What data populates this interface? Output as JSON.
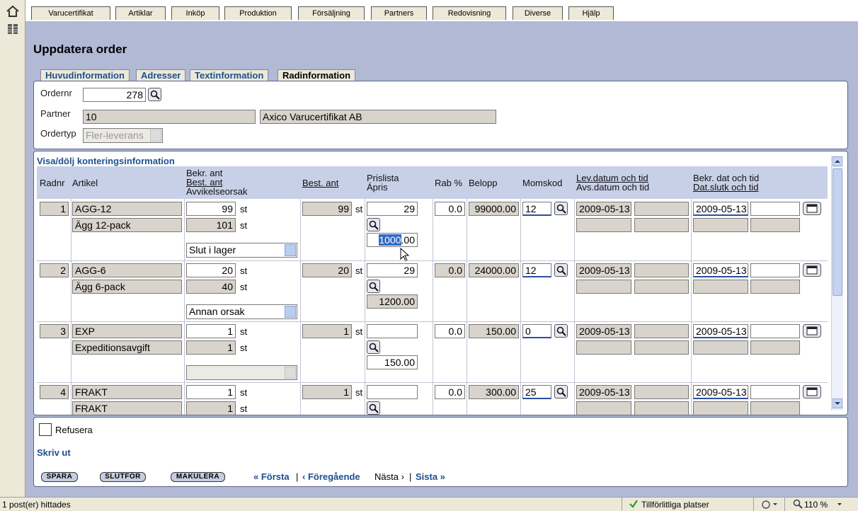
{
  "menu": [
    "Varucertifikat",
    "Artiklar",
    "Inköp",
    "Produktion",
    "Försäljning",
    "Partners",
    "Redovisning",
    "Diverse",
    "Hjälp"
  ],
  "title": "Uppdatera order",
  "tabs": [
    "Huvudinformation",
    "Adresser",
    "Textinformation",
    "Radinformation"
  ],
  "header": {
    "ordernr_label": "Ordernr",
    "ordernr": "278",
    "partner_label": "Partner",
    "partner_id": "10",
    "partner_name": "Axico Varucertifikat AB",
    "ordertyp_label": "Ordertyp",
    "ordertyp": "Fler-leverans"
  },
  "table": {
    "toggle": "Visa/dölj konteringsinformation",
    "col_radnr": "Radnr",
    "col_artikel": "Artikel",
    "col_bekr1": "Bekr. ant",
    "col_bekr2": "Best. ant",
    "col_bekr3": "Avvikelseorsak",
    "col_best": "Best. ant",
    "col_pris1": "Prislista",
    "col_pris2": "Ápris",
    "col_rab": "Rab %",
    "col_belopp": "Belopp",
    "col_moms": "Momskod",
    "col_lev1": "Lev.datum och tid",
    "col_lev2": "Avs.datum och tid",
    "col_bekrdat1": "Bekr. dat och tid",
    "col_bekrdat2": "Dat.slutk och tid",
    "unit": "st",
    "rows": [
      {
        "radnr": "1",
        "artikel": "AGG-12",
        "beskr": "Ägg 12-pack",
        "bekr": "99",
        "best2": "101",
        "orsak": "Slut i lager",
        "best": "99",
        "pris": "29",
        "apris_sel": "1000",
        "apris_rest": ".00",
        "rab": "0.0",
        "belopp": "99000.00",
        "moms": "12",
        "levdat": "2009-05-13",
        "bekrdat": "2009-05-13"
      },
      {
        "radnr": "2",
        "artikel": "AGG-6",
        "beskr": "Ägg 6-pack",
        "bekr": "20",
        "best2": "40",
        "orsak": "Annan orsak",
        "best": "20",
        "pris": "29",
        "apris": "1200.00",
        "rab": "0.0",
        "belopp": "24000.00",
        "moms": "12",
        "levdat": "2009-05-13",
        "bekrdat": "2009-05-13"
      },
      {
        "radnr": "3",
        "artikel": "EXP",
        "beskr": "Expeditionsavgift",
        "bekr": "1",
        "best2": "1",
        "orsak": "",
        "best": "1",
        "pris": "",
        "apris": "150.00",
        "rab": "0.0",
        "belopp": "150.00",
        "moms": "0",
        "levdat": "2009-05-13",
        "bekrdat": "2009-05-13"
      },
      {
        "radnr": "4",
        "artikel": "FRAKT",
        "beskr": "FRAKT",
        "bekr": "1",
        "best2": "1",
        "best": "1",
        "pris": "",
        "rab": "0.0",
        "belopp": "300.00",
        "moms": "25",
        "levdat": "2009-05-13",
        "bekrdat": "2009-05-13"
      }
    ]
  },
  "footer": {
    "refusera": "Refusera",
    "skriv_ut": "Skriv ut",
    "spara": "SPARA",
    "slutfor": "SLUTFÖR",
    "makulera": "MAKULERA",
    "forsta": "« Första",
    "sep": "|",
    "foregaende": "‹ Föregående",
    "nasta": "Nästa ›",
    "sista": "Sista »"
  },
  "status": {
    "left": "1 post(er) hittades",
    "zone": "Tillförlitliga platser",
    "zoom": "110 %"
  },
  "colors": {
    "accent": "#1d4f8f",
    "bg": "#b1b9d5"
  }
}
